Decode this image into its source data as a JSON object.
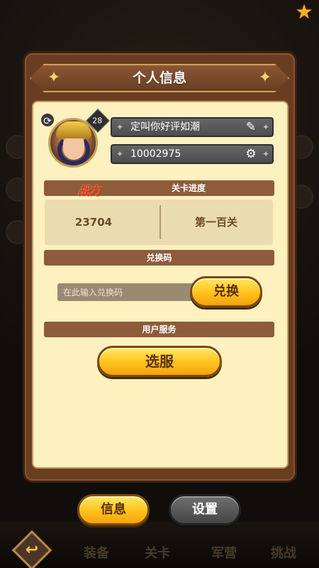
{
  "dialog": {
    "title": "个人信息",
    "level": "28",
    "player_name": "定叫你好评如潮",
    "player_id": "10002975",
    "power_label": "战力",
    "progress_header": "关卡进度",
    "power_value": "23704",
    "stage_value": "第一百关",
    "redeem_header": "兑换码",
    "redeem_placeholder": "在此输入兑换码",
    "redeem_button": "兑换",
    "service_header": "用户服务",
    "server_button": "选服"
  },
  "bottom_buttons": {
    "info": "信息",
    "settings": "设置"
  },
  "background_tabs": [
    "装备",
    "关卡",
    "军营",
    "挑战"
  ],
  "icons": {
    "edit": "edit-icon",
    "settings": "gear-icon",
    "refresh": "refresh-icon",
    "star": "star-icon",
    "back": "back-arrow-icon"
  },
  "colors": {
    "panel_border": "#6a3d22",
    "panel_fill": "#fdf1bf",
    "gold_button": "#ffc21a",
    "gray_button": "#555555"
  }
}
